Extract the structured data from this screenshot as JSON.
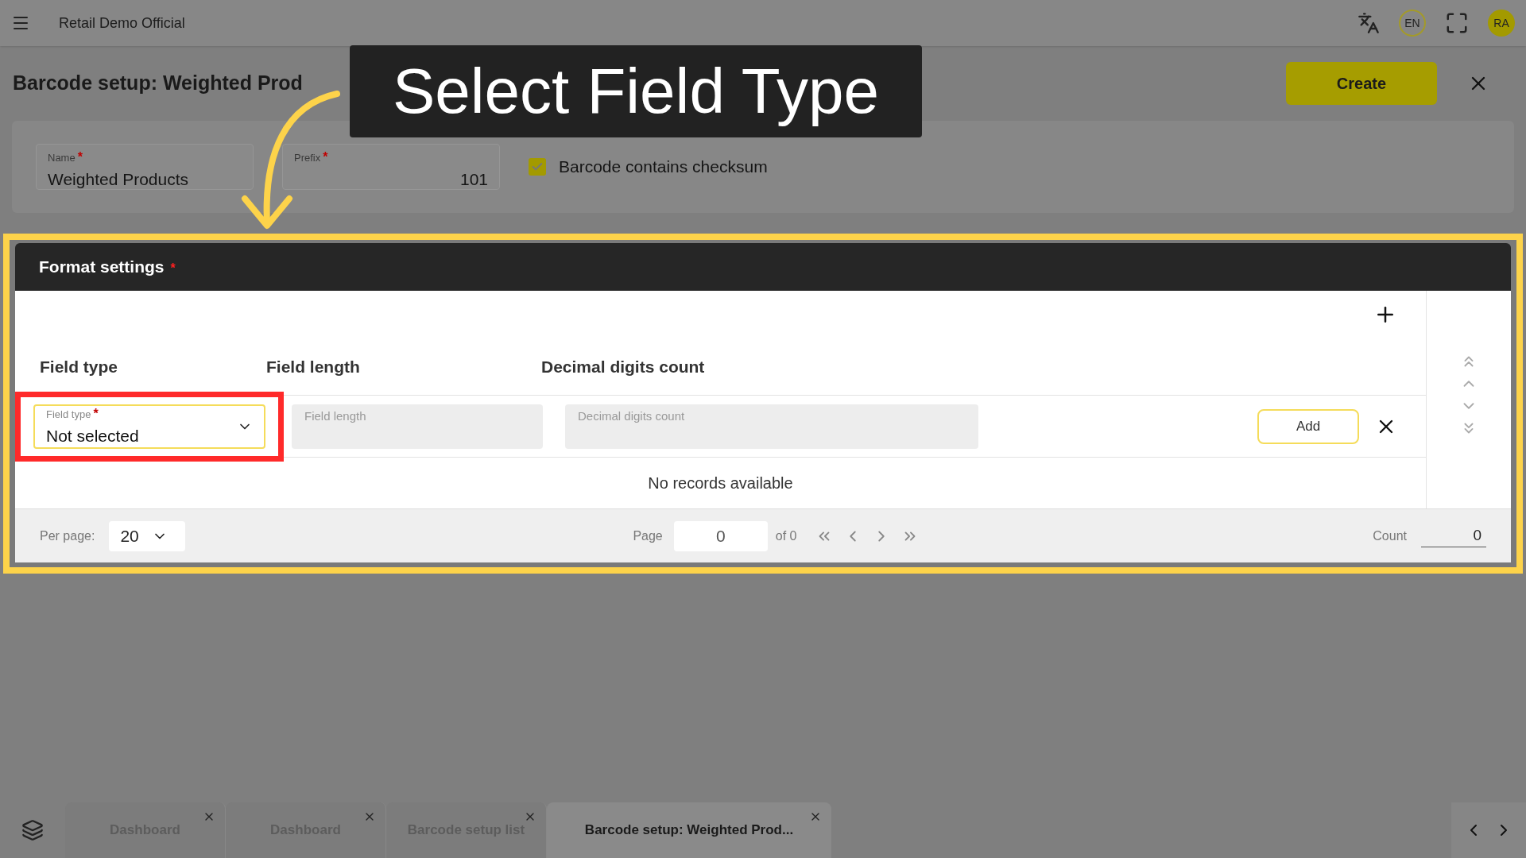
{
  "top_bar": {
    "app_name": "Retail Demo Official",
    "language": "EN",
    "avatar_initials": "RA"
  },
  "page": {
    "title": "Barcode setup: Weighted Prod",
    "create_button": "Create"
  },
  "callout": {
    "text": "Select Field Type"
  },
  "form": {
    "fields": [
      {
        "label": "Name",
        "required_mark": "*",
        "value": "Weighted Products",
        "kind": "text"
      },
      {
        "label": "Prefix",
        "required_mark": "*",
        "value": "101",
        "kind": "number"
      }
    ],
    "checkbox": {
      "label": "Barcode contains checksum",
      "checked": true
    }
  },
  "format_settings": {
    "title": "Format settings",
    "required_mark": "*",
    "columns": [
      "Field type",
      "Field length",
      "Decimal digits count"
    ],
    "new_row": {
      "field_type": {
        "label": "Field type",
        "required_mark": "*",
        "value": "Not selected",
        "highlighted": true
      },
      "field_length": {
        "placeholder": "Field length"
      },
      "decimal_digits": {
        "placeholder": "Decimal digits count"
      },
      "add_button": "Add"
    },
    "empty_message": "No records available",
    "pagination": {
      "per_page_label": "Per page:",
      "per_page": "20",
      "page_label": "Page",
      "page": "0",
      "of": "of 0",
      "count_label": "Count",
      "count": "0"
    }
  },
  "tabs": [
    {
      "label": "Dashboard",
      "selected": false
    },
    {
      "label": "Dashboard",
      "selected": false
    },
    {
      "label": "Barcode setup list",
      "selected": false
    },
    {
      "label": "Barcode setup: Weighted Prod...",
      "selected": true
    }
  ]
}
